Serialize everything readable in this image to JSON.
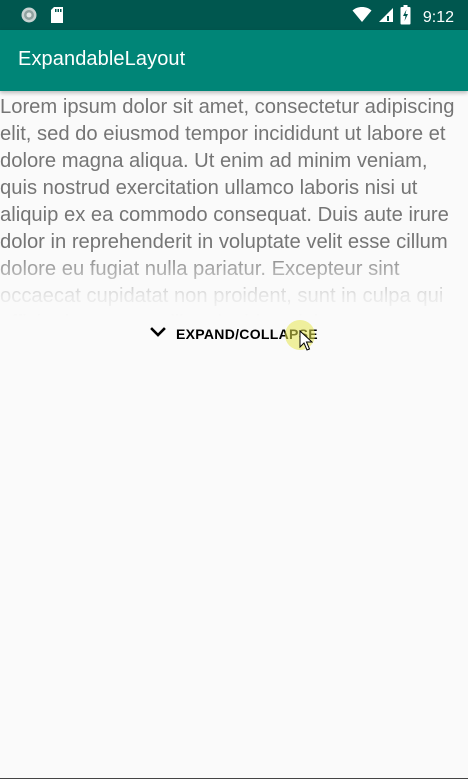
{
  "status_bar": {
    "time": "9:12",
    "left_icons": [
      "app-notification-icon",
      "sd-card-icon"
    ],
    "right_icons": [
      "wifi-icon",
      "cell-signal-icon",
      "battery-icon"
    ]
  },
  "app_bar": {
    "title": "ExpandableLayout",
    "color": "#008577",
    "status_color": "#00574f"
  },
  "content": {
    "text": "Lorem ipsum dolor sit amet, consectetur adipiscing elit, sed do eiusmod tempor incididunt ut labore et dolore magna aliqua. Ut enim ad minim veniam, quis nostrud exercitation ullamco laboris nisi ut aliquip ex ea commodo consequat. Duis aute irure dolor in reprehenderit in voluptate velit esse cillum dolore eu fugiat nulla pariatur. Excepteur sint occaecat cupidatat non proident, sunt in culpa qui officia deserunt mollit anim id est laborum."
  },
  "toggle": {
    "label": "EXPAND/COLLAPSE",
    "icon": "chevron-down-icon"
  }
}
